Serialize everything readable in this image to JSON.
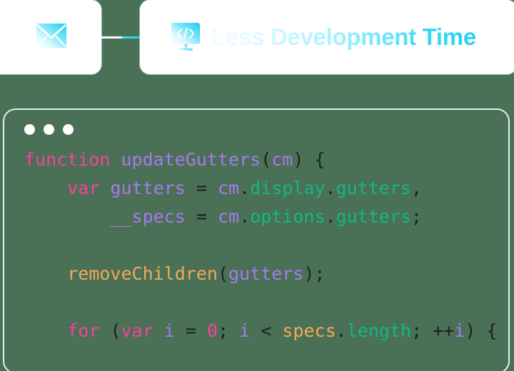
{
  "cards": {
    "mail": {
      "icon": "envelope-icon"
    },
    "dev": {
      "icon": "monitor-code-icon",
      "title": "Less Development Time"
    }
  },
  "connector": {
    "name": "card-connector-line"
  },
  "code_panel": {
    "window_dots": [
      "dot-1",
      "dot-2",
      "dot-3"
    ],
    "language": "javascript",
    "code_text": "function updateGutters(cm) {\n    var gutters = cm.display.gutters,\n        __specs = cm.options.gutters;\n\n    removeChildren(gutters);\n\n    for (var i = 0; i < specs.length; ++i) {",
    "lines": [
      {
        "indent": 0,
        "tokens": [
          {
            "t": "function",
            "c": "keyword"
          },
          {
            "t": " ",
            "c": "plain"
          },
          {
            "t": "updateGutters",
            "c": "ident"
          },
          {
            "t": "(",
            "c": "punct"
          },
          {
            "t": "cm",
            "c": "ident"
          },
          {
            "t": ")",
            "c": "punct"
          },
          {
            "t": " ",
            "c": "plain"
          },
          {
            "t": "{",
            "c": "punct"
          }
        ]
      },
      {
        "indent": 4,
        "tokens": [
          {
            "t": "var",
            "c": "keyword"
          },
          {
            "t": " ",
            "c": "plain"
          },
          {
            "t": "gutters",
            "c": "ident"
          },
          {
            "t": " ",
            "c": "plain"
          },
          {
            "t": "=",
            "c": "punct"
          },
          {
            "t": " ",
            "c": "plain"
          },
          {
            "t": "cm",
            "c": "ident"
          },
          {
            "t": ".",
            "c": "punct"
          },
          {
            "t": "display",
            "c": "prop"
          },
          {
            "t": ".",
            "c": "punct"
          },
          {
            "t": "gutters",
            "c": "prop"
          },
          {
            "t": ",",
            "c": "punct"
          }
        ]
      },
      {
        "indent": 8,
        "tokens": [
          {
            "t": "__specs",
            "c": "ident"
          },
          {
            "t": " ",
            "c": "plain"
          },
          {
            "t": "=",
            "c": "punct"
          },
          {
            "t": " ",
            "c": "plain"
          },
          {
            "t": "cm",
            "c": "ident"
          },
          {
            "t": ".",
            "c": "punct"
          },
          {
            "t": "options",
            "c": "prop"
          },
          {
            "t": ".",
            "c": "punct"
          },
          {
            "t": "gutters",
            "c": "prop"
          },
          {
            "t": ";",
            "c": "punct"
          }
        ]
      },
      {
        "indent": 0,
        "tokens": []
      },
      {
        "indent": 4,
        "tokens": [
          {
            "t": "removeChildren",
            "c": "func"
          },
          {
            "t": "(",
            "c": "punct"
          },
          {
            "t": "gutters",
            "c": "ident"
          },
          {
            "t": ")",
            "c": "punct"
          },
          {
            "t": ";",
            "c": "punct"
          }
        ]
      },
      {
        "indent": 0,
        "tokens": []
      },
      {
        "indent": 4,
        "tokens": [
          {
            "t": "for",
            "c": "keyword"
          },
          {
            "t": " ",
            "c": "plain"
          },
          {
            "t": "(",
            "c": "punct"
          },
          {
            "t": "var",
            "c": "keyword"
          },
          {
            "t": " ",
            "c": "plain"
          },
          {
            "t": "i",
            "c": "ident"
          },
          {
            "t": " ",
            "c": "plain"
          },
          {
            "t": "=",
            "c": "punct"
          },
          {
            "t": " ",
            "c": "plain"
          },
          {
            "t": "0",
            "c": "num"
          },
          {
            "t": ";",
            "c": "punct"
          },
          {
            "t": " ",
            "c": "plain"
          },
          {
            "t": "i",
            "c": "ident"
          },
          {
            "t": " ",
            "c": "plain"
          },
          {
            "t": "<",
            "c": "punct"
          },
          {
            "t": " ",
            "c": "plain"
          },
          {
            "t": "specs",
            "c": "func"
          },
          {
            "t": ".",
            "c": "punct"
          },
          {
            "t": "length",
            "c": "prop"
          },
          {
            "t": ";",
            "c": "punct"
          },
          {
            "t": " ",
            "c": "plain"
          },
          {
            "t": "++",
            "c": "punct"
          },
          {
            "t": "i",
            "c": "ident"
          },
          {
            "t": ")",
            "c": "punct"
          },
          {
            "t": " ",
            "c": "plain"
          },
          {
            "t": "{",
            "c": "punct"
          }
        ]
      }
    ]
  },
  "colors": {
    "background": "#4a7055",
    "card_background": "#ffffff",
    "accent_cyan": "#22d3ee",
    "accent_cyan_light": "#a5f0fd",
    "code_keyword": "#f940a0",
    "code_identifier": "#a878f0",
    "code_property": "#12b886",
    "code_function": "#f4a85a",
    "code_punctuation": "#1c2121"
  }
}
